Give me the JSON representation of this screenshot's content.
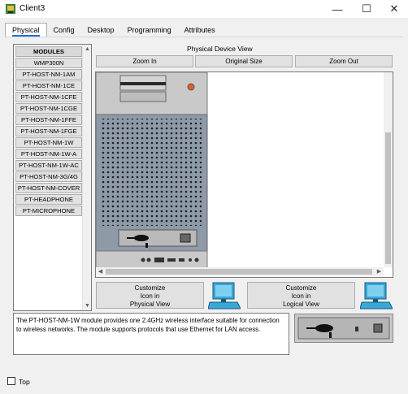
{
  "window": {
    "title": "Client3",
    "controls": {
      "minimize": "—",
      "maximize": "☐",
      "close": "✕"
    }
  },
  "tabs": [
    {
      "label": "Physical",
      "active": true
    },
    {
      "label": "Config",
      "active": false
    },
    {
      "label": "Desktop",
      "active": false
    },
    {
      "label": "Programming",
      "active": false
    },
    {
      "label": "Attributes",
      "active": false
    }
  ],
  "modules": {
    "items": [
      "MODULES",
      "WMP300N",
      "PT-HOST-NM-1AM",
      "PT-HOST-NM-1CE",
      "PT-HOST-NM-1CFE",
      "PT-HOST-NM-1CGE",
      "PT-HOST-NM-1FFE",
      "PT-HOST-NM-1FGE",
      "PT-HOST-NM-1W",
      "PT-HOST-NM-1W-A",
      "PT-HOST-NM-1W-AC",
      "PT-HOST-NM-3G/4G",
      "PT-HOST-NM-COVER",
      "PT-HEADPHONE",
      "PT-MICROPHONE"
    ]
  },
  "physical_view": {
    "title": "Physical Device View",
    "zoom_in": "Zoom In",
    "original_size": "Original Size",
    "zoom_out": "Zoom Out"
  },
  "customize": {
    "physical": [
      "Customize",
      "Icon in",
      "Physical View"
    ],
    "logical": [
      "Customize",
      "Icon in",
      "Logical View"
    ]
  },
  "description": "The PT-HOST-NM-1W module provides one 2.4GHz wireless interface suitable for connection to wireless networks. The module supports protocols that use Ethernet for LAN access.",
  "footer": {
    "top_label": "Top",
    "top_checked": false
  },
  "colors": {
    "accent": "#1f6fe0",
    "device_panel": "#8e9aa8",
    "device_top": "#c9c9c9"
  }
}
